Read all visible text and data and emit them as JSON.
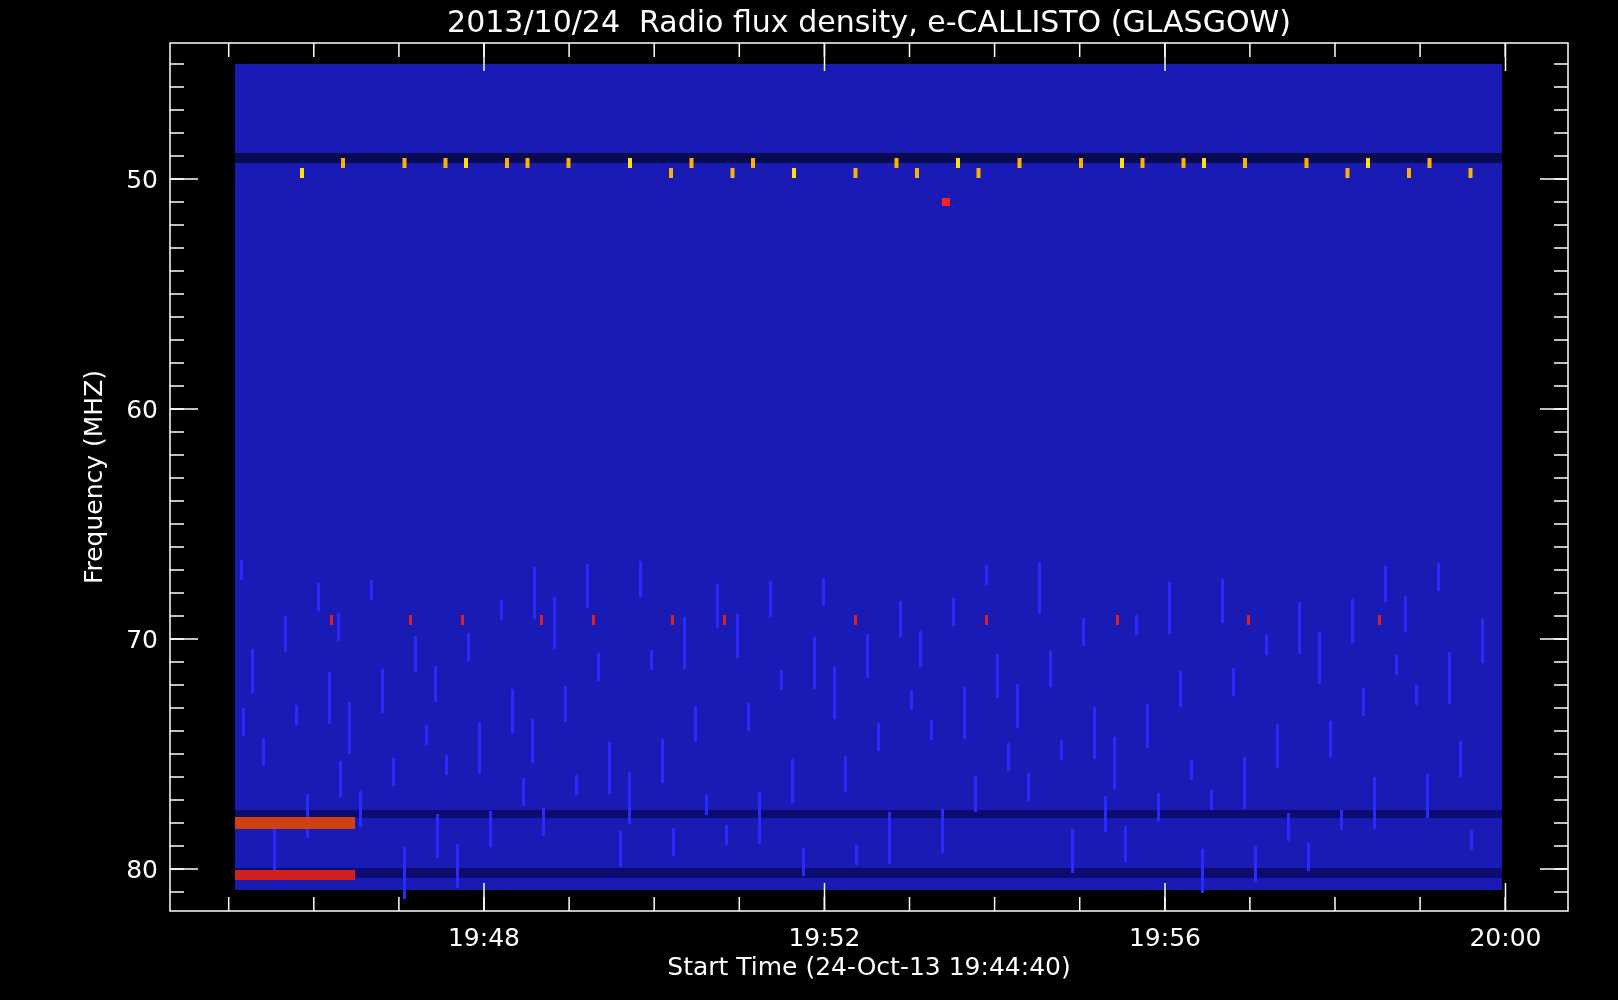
{
  "plot": {
    "title": "2013/10/24  Radio flux density, e-CALLISTO (GLASGOW)",
    "xlabel": "Start Time (24-Oct-13 19:44:40)",
    "ylabel": "Frequency (MHZ)",
    "x_tick_labels": [
      "19:48",
      "19:52",
      "19:56",
      "20:00"
    ],
    "y_tick_labels": [
      "50",
      "60",
      "70",
      "80"
    ]
  }
}
